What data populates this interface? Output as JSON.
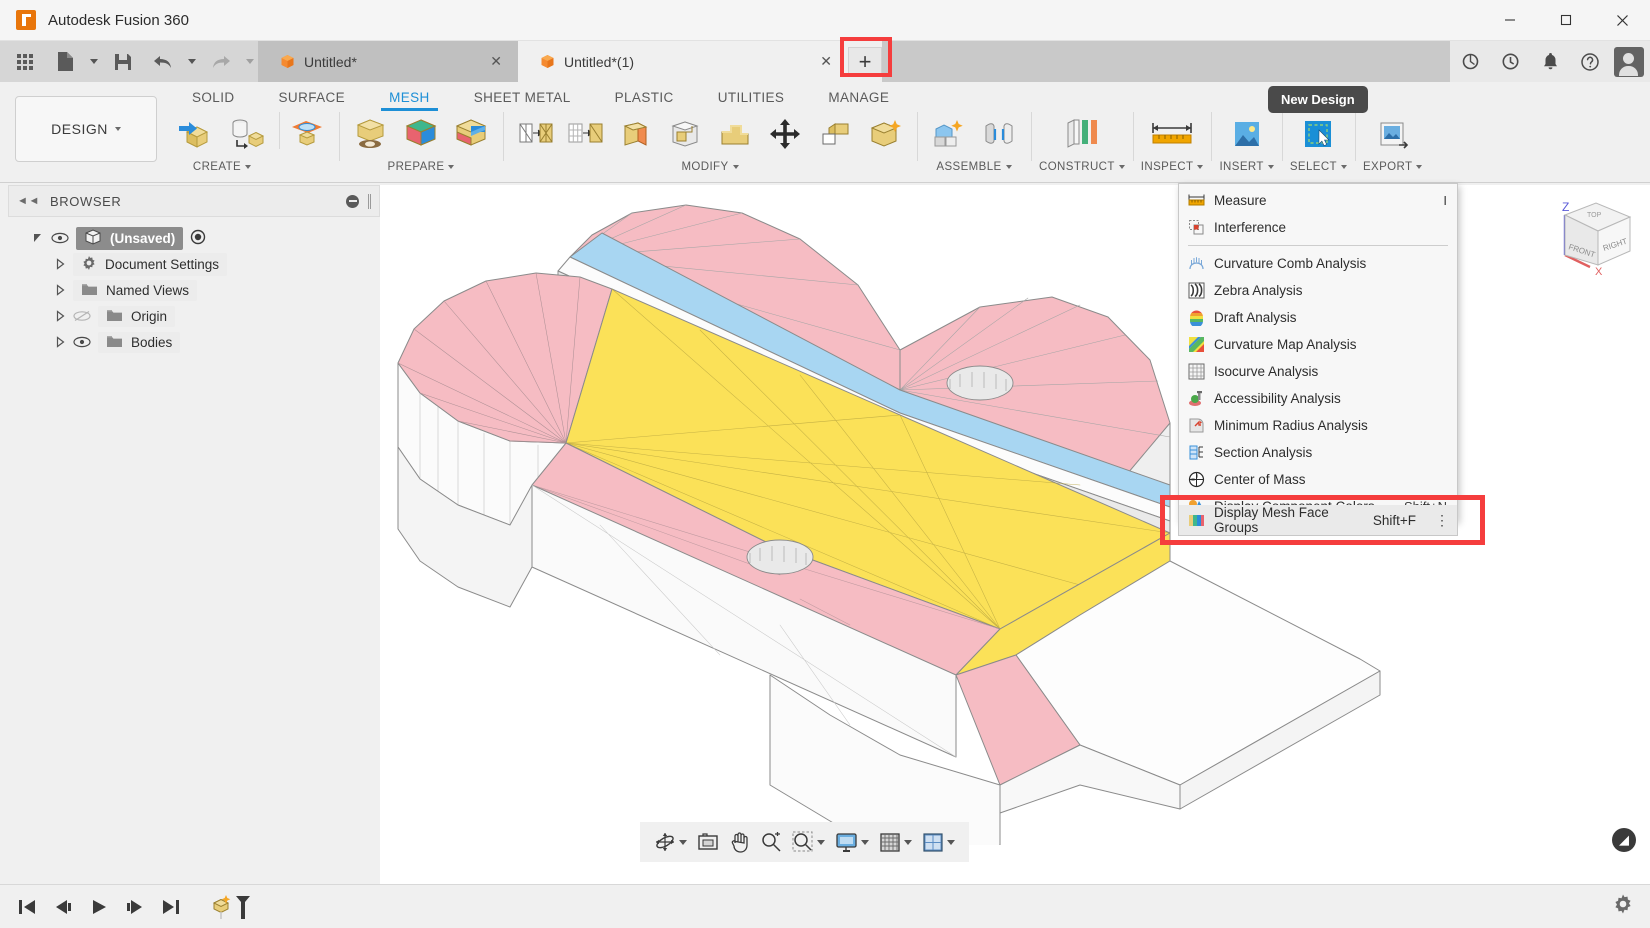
{
  "window": {
    "title": "Autodesk Fusion 360",
    "app_icon": "fusion-logo-icon",
    "controls": {
      "minimize": "—",
      "maximize": "□",
      "close": "✕"
    }
  },
  "quick_access": {
    "buttons": [
      {
        "name": "app-grid-icon",
        "label": ""
      },
      {
        "name": "new-file-icon",
        "label": ""
      },
      {
        "name": "save-icon",
        "label": ""
      },
      {
        "name": "undo-icon",
        "label": ""
      },
      {
        "name": "redo-icon",
        "label": ""
      }
    ]
  },
  "document_tabs": [
    {
      "label": "Untitled*",
      "active": false,
      "close": "✕",
      "icon": "cube-icon"
    },
    {
      "label": "Untitled*(1)",
      "active": true,
      "close": "✕",
      "icon": "cube-icon"
    }
  ],
  "new_design": {
    "button_label": "+",
    "tooltip": "New Design",
    "highlighted": true,
    "highlight_color": "#f53d3d"
  },
  "title_right_icons": [
    {
      "name": "refresh-icon"
    },
    {
      "name": "recent-icon"
    },
    {
      "name": "notifications-bell-icon"
    },
    {
      "name": "help-icon"
    },
    {
      "name": "user-avatar"
    }
  ],
  "workspace": {
    "label": "DESIGN",
    "caret": "▾"
  },
  "ribbon_tabs": [
    {
      "label": "SOLID",
      "active": false
    },
    {
      "label": "SURFACE",
      "active": false
    },
    {
      "label": "MESH",
      "active": true
    },
    {
      "label": "SHEET METAL",
      "active": false
    },
    {
      "label": "PLASTIC",
      "active": false
    },
    {
      "label": "UTILITIES",
      "active": false
    },
    {
      "label": "MANAGE",
      "active": false
    }
  ],
  "ribbon_panels": [
    {
      "label": "CREATE",
      "has_caret": true,
      "tools": [
        "create-mesh-icon",
        "mesh-from-brep-icon",
        "mesh-plane-icon"
      ]
    },
    {
      "label": "PREPARE",
      "has_caret": true,
      "tools": [
        "remesh-icon",
        "face-groups-icon",
        "generate-face-groups-icon"
      ]
    },
    {
      "label": "MODIFY",
      "has_caret": true,
      "tools": [
        "reduce-icon",
        "make-closed-mesh-icon",
        "plane-cut-icon",
        "erase-fill-icon",
        "smooth-icon",
        "move-copy-icon",
        "delete-icon",
        "repair-icon"
      ]
    },
    {
      "label": "ASSEMBLE",
      "has_caret": true,
      "tools": [
        "new-component-icon",
        "joint-icon"
      ]
    },
    {
      "label": "CONSTRUCT",
      "has_caret": true,
      "tools": [
        "offset-plane-icon"
      ]
    },
    {
      "label": "INSPECT",
      "has_caret": true,
      "tools": [
        "measure-icon"
      ]
    },
    {
      "label": "INSERT",
      "has_caret": true,
      "tools": [
        "insert-mcmaster-icon"
      ]
    },
    {
      "label": "SELECT",
      "has_caret": true,
      "tools": [
        "select-window-icon"
      ]
    },
    {
      "label": "EXPORT",
      "has_caret": true,
      "tools": [
        "export-icon"
      ]
    }
  ],
  "inspect_menu": {
    "open": true,
    "items": [
      {
        "label": "Measure",
        "shortcut": "I",
        "icon": "measure-ruler-icon",
        "separator_after": true
      },
      {
        "label": "Interference",
        "shortcut": "",
        "icon": "interference-icon",
        "separator_after": true
      },
      {
        "label": "Curvature Comb Analysis",
        "shortcut": "",
        "icon": "curvature-comb-icon"
      },
      {
        "label": "Zebra Analysis",
        "shortcut": "",
        "icon": "zebra-icon"
      },
      {
        "label": "Draft Analysis",
        "shortcut": "",
        "icon": "draft-analysis-icon"
      },
      {
        "label": "Curvature Map Analysis",
        "shortcut": "",
        "icon": "curvature-map-icon"
      },
      {
        "label": "Isocurve Analysis",
        "shortcut": "",
        "icon": "isocurve-icon"
      },
      {
        "label": "Accessibility Analysis",
        "shortcut": "",
        "icon": "accessibility-icon"
      },
      {
        "label": "Minimum Radius Analysis",
        "shortcut": "",
        "icon": "minimum-radius-icon"
      },
      {
        "label": "Section Analysis",
        "shortcut": "",
        "icon": "section-analysis-icon"
      },
      {
        "label": "Center of Mass",
        "shortcut": "",
        "icon": "center-of-mass-icon"
      },
      {
        "label": "Display Component Colors",
        "shortcut": "Shift+N",
        "icon": "component-colors-icon"
      }
    ],
    "highlighted_item": {
      "label": "Display Mesh Face Groups",
      "shortcut": "Shift+F",
      "icon": "mesh-face-groups-icon",
      "overflow": "⋮",
      "highlighted": true,
      "highlight_color": "#f53d3d"
    }
  },
  "browser": {
    "title": "BROWSER",
    "collapse_icon": "collapse-left-icon",
    "tree": [
      {
        "label": "(Unsaved)",
        "depth": 0,
        "selected": true,
        "expanded": true,
        "visible": true,
        "icon": "component-cube-icon",
        "has_activate_radio": true
      },
      {
        "label": "Document Settings",
        "depth": 1,
        "selected": false,
        "expanded": false,
        "visible": true,
        "icon": "gear-icon",
        "has_eye": false
      },
      {
        "label": "Named Views",
        "depth": 1,
        "selected": false,
        "expanded": false,
        "visible": true,
        "icon": "folder-icon",
        "has_eye": false
      },
      {
        "label": "Origin",
        "depth": 1,
        "selected": false,
        "expanded": false,
        "visible": false,
        "icon": "folder-icon",
        "has_eye": true
      },
      {
        "label": "Bodies",
        "depth": 1,
        "selected": false,
        "expanded": false,
        "visible": true,
        "icon": "folder-icon",
        "has_eye": true
      }
    ]
  },
  "canvas": {
    "background": "#ffffff",
    "model_name": "mesh-bracket-model",
    "face_group_colors": {
      "pink": "#f6bcc3",
      "yellow": "#fbe158",
      "blue": "#a8d6f2",
      "white": "#fbfbfb",
      "edge": "#8a8a8a"
    },
    "view_cube": {
      "axis_z": "Z",
      "axis_x": "X",
      "face_front": "FRONT",
      "face_right": "RIGHT",
      "face_top": "TOP"
    }
  },
  "nav_toolbar": {
    "buttons": [
      {
        "name": "orbit-icon",
        "has_caret": true
      },
      {
        "name": "look-at-icon",
        "has_caret": false
      },
      {
        "name": "pan-hand-icon",
        "has_caret": false
      },
      {
        "name": "zoom-icon",
        "has_caret": false
      },
      {
        "name": "zoom-window-icon",
        "has_caret": true
      },
      {
        "name": "display-settings-icon",
        "has_caret": true
      },
      {
        "name": "grid-snaps-icon",
        "has_caret": true
      },
      {
        "name": "viewports-icon",
        "has_caret": true
      }
    ]
  },
  "help_bubble": {
    "name": "help-chat-icon",
    "glyph": "◢"
  },
  "timeline": {
    "buttons": [
      {
        "name": "go-to-beginning-icon"
      },
      {
        "name": "step-back-icon"
      },
      {
        "name": "play-icon"
      },
      {
        "name": "step-forward-icon"
      },
      {
        "name": "go-to-end-icon"
      }
    ],
    "marker": {
      "name": "timeline-marker-icon"
    },
    "settings": {
      "name": "timeline-settings-gear-icon"
    }
  }
}
